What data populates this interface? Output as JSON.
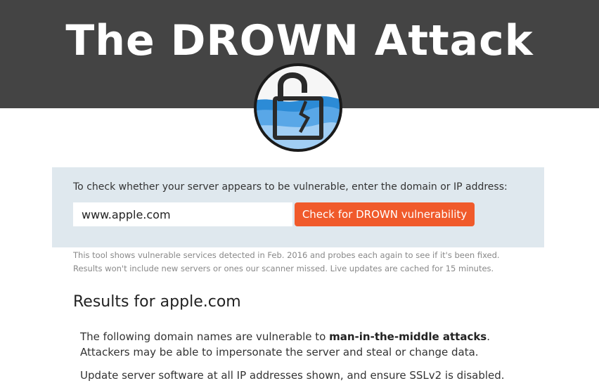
{
  "header": {
    "title": "The DROWN Attack",
    "background_color": "#444444"
  },
  "logo": {
    "icon": "broken-padlock-icon"
  },
  "check_form": {
    "prompt": "To check whether your server appears to be vulnerable, enter the domain or IP address:",
    "input_value": "www.apple.com",
    "button_label": "Check for DROWN vulnerability",
    "panel_color": "#dfe8ee",
    "button_color": "#f05a2b"
  },
  "tool_note": {
    "line1": "This tool shows vulnerable services detected in Feb. 2016 and probes each again to see if it's been fixed.",
    "line2": "Results won't include new servers or ones our scanner missed. Live updates are cached for 15 minutes."
  },
  "results": {
    "heading": "Results for apple.com",
    "para1_prefix": "The following domain names are vulnerable to ",
    "para1_emphasis": "man-in-the-middle attacks",
    "para1_suffix": ".",
    "para1_line2": "Attackers may be able to impersonate the server and steal or change data.",
    "para2": "Update server software at all IP addresses shown, and ensure SSLv2 is disabled."
  }
}
